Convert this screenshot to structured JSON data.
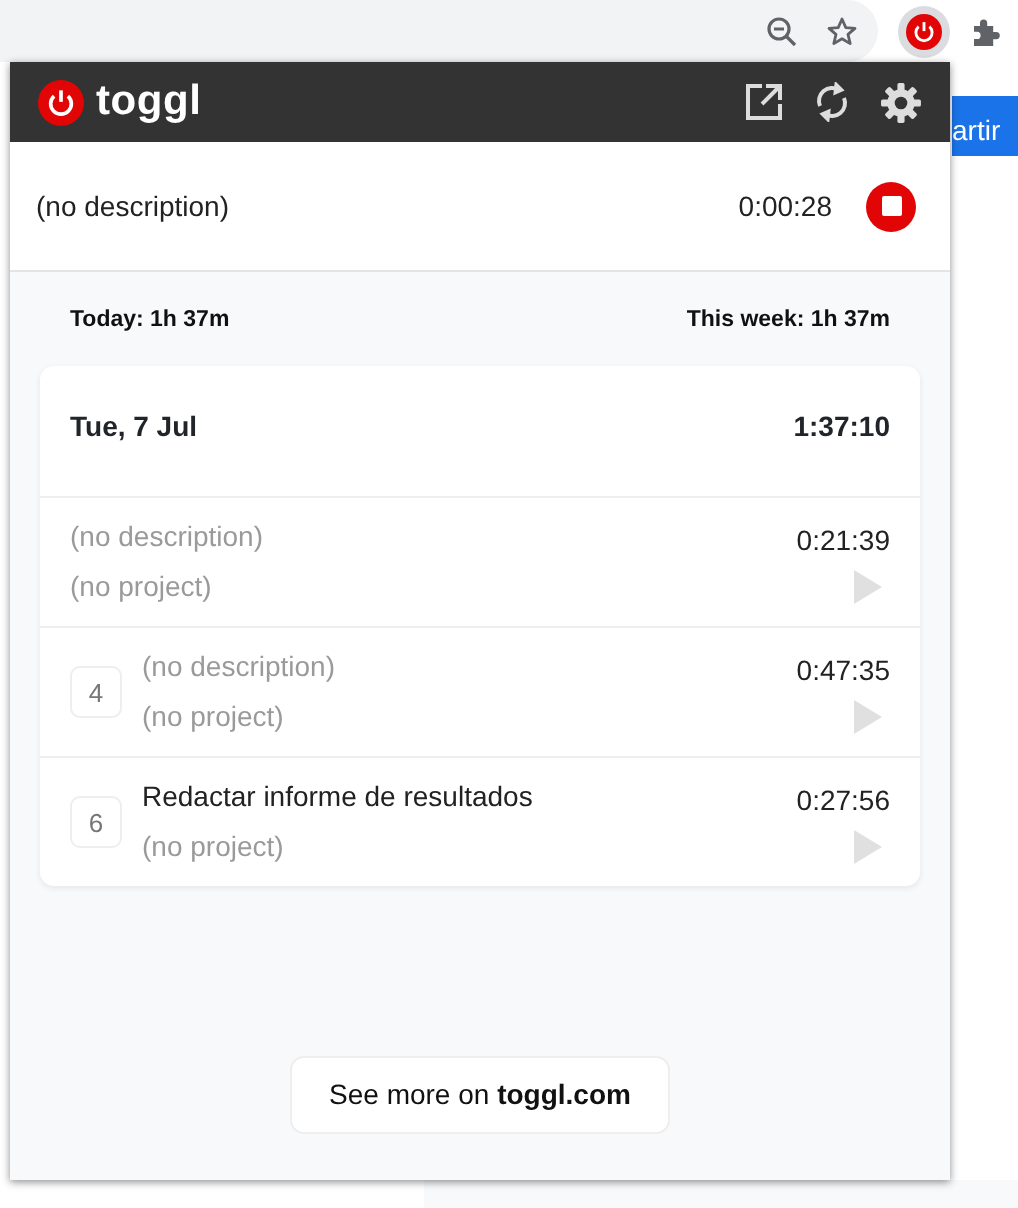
{
  "background_page": {
    "button": "artir"
  },
  "popup": {
    "logo": "toggl",
    "running": {
      "description": "(no description)",
      "duration": "0:00:28"
    },
    "summary": {
      "today": "Today: 1h 37m",
      "week": "This week: 1h 37m"
    },
    "day": {
      "date": "Tue, 7 Jul",
      "total": "1:37:10",
      "entries": [
        {
          "description": "(no description)",
          "untitled": true,
          "project": "(no project)",
          "duration": "0:21:39"
        },
        {
          "count": "4",
          "description": "(no description)",
          "untitled": true,
          "project": "(no project)",
          "duration": "0:47:35"
        },
        {
          "count": "6",
          "description": "Redactar informe de resultados",
          "untitled": false,
          "project": "(no project)",
          "duration": "0:27:56"
        }
      ]
    },
    "footer_link": "See more on **toggl.com**"
  }
}
